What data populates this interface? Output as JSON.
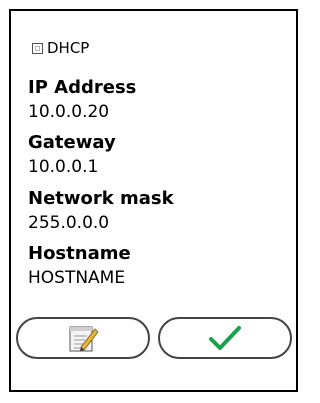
{
  "form": {
    "dhcp_label": "DHCP",
    "dhcp_checked": false,
    "fields": [
      {
        "label": "IP Address",
        "value": "10.0.0.20"
      },
      {
        "label": "Gateway",
        "value": "10.0.0.1"
      },
      {
        "label": "Network mask",
        "value": "255.0.0.0"
      },
      {
        "label": "Hostname",
        "value": "HOSTNAME"
      }
    ]
  },
  "buttons": {
    "edit_icon": "notepad-pencil-icon",
    "confirm_icon": "checkmark-icon",
    "confirm_color": "#1aa24a"
  }
}
